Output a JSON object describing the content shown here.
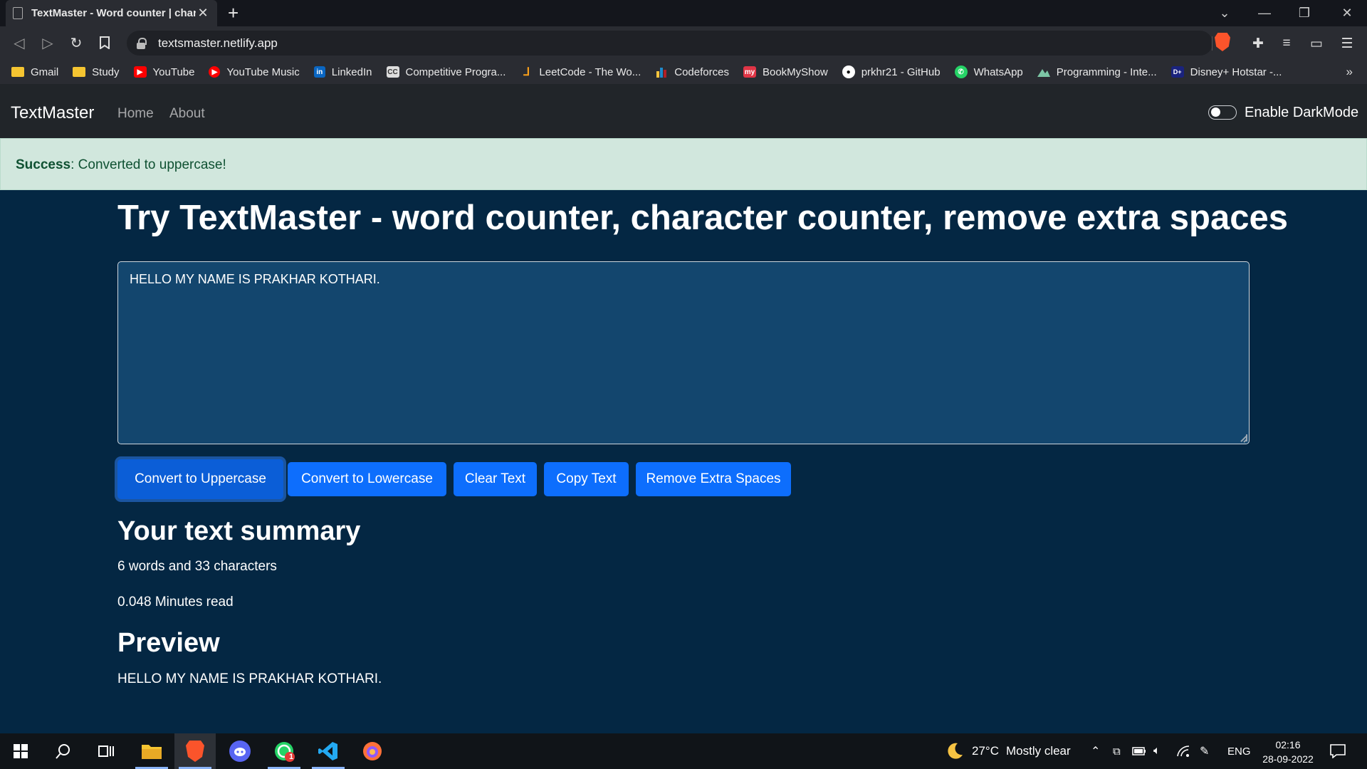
{
  "browser": {
    "tab_title": "TextMaster - Word counter | character counter",
    "url": "textsmaster.netlify.app",
    "bookmarks": [
      {
        "label": "Gmail",
        "icon": "folder-icon",
        "color": "#f5c531"
      },
      {
        "label": "Study",
        "icon": "folder-icon",
        "color": "#f5c531"
      },
      {
        "label": "YouTube",
        "icon": "youtube-icon",
        "color": "#ff0000"
      },
      {
        "label": "YouTube Music",
        "icon": "youtube-music-icon",
        "color": "#ff0000"
      },
      {
        "label": "LinkedIn",
        "icon": "linkedin-icon",
        "color": "#0a66c2"
      },
      {
        "label": "Competitive Progra...",
        "icon": "codechef-icon",
        "color": "#888888"
      },
      {
        "label": "LeetCode - The Wo...",
        "icon": "leetcode-icon",
        "color": "#f89f1b"
      },
      {
        "label": "Codeforces",
        "icon": "codeforces-icon",
        "color": "#1f8acb"
      },
      {
        "label": "BookMyShow",
        "icon": "bookmyshow-icon",
        "color": "#e03546"
      },
      {
        "label": "prkhr21 - GitHub",
        "icon": "github-icon",
        "color": "#ffffff"
      },
      {
        "label": "WhatsApp",
        "icon": "whatsapp-icon",
        "color": "#25d366"
      },
      {
        "label": "Programming - Inte...",
        "icon": "mountain-icon",
        "color": "#7cc6a5"
      },
      {
        "label": "Disney+ Hotstar -...",
        "icon": "hotstar-icon",
        "color": "#1a237e"
      }
    ]
  },
  "navbar": {
    "brand": "TextMaster",
    "links": [
      "Home",
      "About"
    ],
    "dark_mode_label": "Enable DarkMode"
  },
  "alert": {
    "type": "Success",
    "message": ": Converted to uppercase!"
  },
  "main": {
    "heading": "Try TextMaster - word counter, character counter, remove extra spaces",
    "textarea_value": "HELLO MY NAME IS PRAKHAR KOTHARI.",
    "buttons": [
      "Convert to Uppercase",
      "Convert to Lowercase",
      "Clear Text",
      "Copy Text",
      "Remove Extra Spaces"
    ],
    "summary_title": "Your text summary",
    "summary_counts": "6 words and 33 characters",
    "read_time": "0.048 Minutes read",
    "preview_title": "Preview",
    "preview_text": "HELLO MY NAME IS PRAKHAR KOTHARI."
  },
  "taskbar": {
    "weather_temp": "27°C",
    "weather_desc": "Mostly clear",
    "language": "ENG",
    "time": "02:16",
    "date": "28-09-2022",
    "whatsapp_badge": "1"
  },
  "colors": {
    "page_bg": "#042743",
    "navbar_bg": "#212529",
    "button": "#0d6efd",
    "alert_bg": "#d1e7dd",
    "alert_text": "#0f5132"
  }
}
